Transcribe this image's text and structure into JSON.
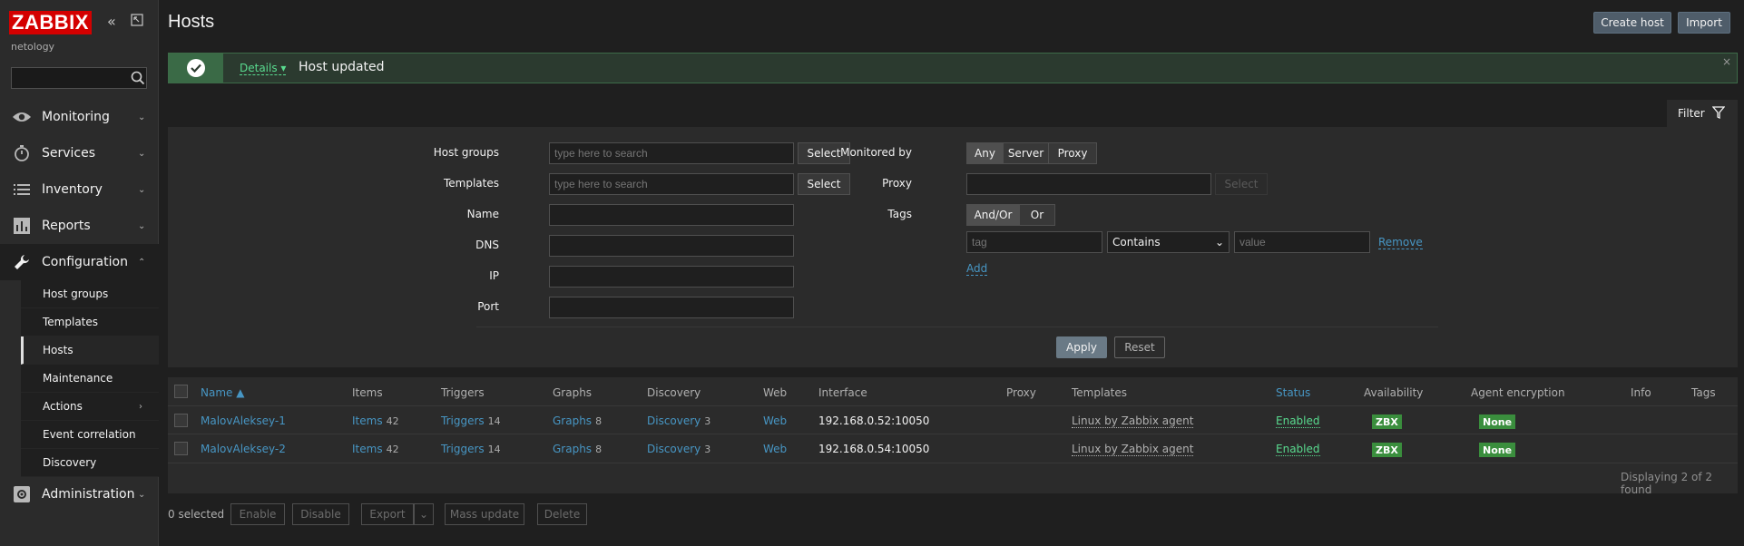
{
  "sidebar": {
    "logo": "ZABBIX",
    "collapse_icon": "double-chevron-left-icon",
    "kiosk_icon": "kiosk-icon",
    "server_name": "netology",
    "search_placeholder": "",
    "menu": [
      {
        "label": "Monitoring",
        "icon": "eye-icon"
      },
      {
        "label": "Services",
        "icon": "clock-icon"
      },
      {
        "label": "Inventory",
        "icon": "list-icon"
      },
      {
        "label": "Reports",
        "icon": "bar-chart-icon"
      },
      {
        "label": "Configuration",
        "icon": "wrench-icon"
      },
      {
        "label": "Administration",
        "icon": "gear-icon"
      }
    ],
    "config_items": [
      "Host groups",
      "Templates",
      "Hosts",
      "Maintenance",
      "Actions",
      "Event correlation",
      "Discovery"
    ]
  },
  "header": {
    "title": "Hosts",
    "create_host": "Create host",
    "import": "Import"
  },
  "message": {
    "details": "Details",
    "text": "Host updated",
    "close": "×"
  },
  "filter": {
    "tab_label": "Filter",
    "host_groups_label": "Host groups",
    "host_groups_placeholder": "type here to search",
    "templates_label": "Templates",
    "templates_placeholder": "type here to search",
    "select": "Select",
    "name_label": "Name",
    "dns_label": "DNS",
    "ip_label": "IP",
    "port_label": "Port",
    "monitored_by_label": "Monitored by",
    "monitored_by_options": [
      "Any",
      "Server",
      "Proxy"
    ],
    "proxy_label": "Proxy",
    "tags_label": "Tags",
    "tags_options": [
      "And/Or",
      "Or"
    ],
    "tag_placeholder": "tag",
    "operator": "Contains",
    "value_placeholder": "value",
    "remove": "Remove",
    "add": "Add",
    "apply": "Apply",
    "reset": "Reset"
  },
  "table": {
    "columns": [
      "Name ▲",
      "Items",
      "Triggers",
      "Graphs",
      "Discovery",
      "Web",
      "Interface",
      "Proxy",
      "Templates",
      "Status",
      "Availability",
      "Agent encryption",
      "Info",
      "Tags"
    ],
    "rows": [
      {
        "name": "MalovAleksey-1",
        "items": "Items",
        "items_count": "42",
        "triggers": "Triggers",
        "triggers_count": "14",
        "graphs": "Graphs",
        "graphs_count": "8",
        "discovery": "Discovery",
        "discovery_count": "3",
        "web": "Web",
        "interface": "192.168.0.52:10050",
        "template": "Linux by Zabbix agent",
        "status": "Enabled",
        "availability": "ZBX",
        "encryption": "None"
      },
      {
        "name": "MalovAleksey-2",
        "items": "Items",
        "items_count": "42",
        "triggers": "Triggers",
        "triggers_count": "14",
        "graphs": "Graphs",
        "graphs_count": "8",
        "discovery": "Discovery",
        "discovery_count": "3",
        "web": "Web",
        "interface": "192.168.0.54:10050",
        "template": "Linux by Zabbix agent",
        "status": "Enabled",
        "availability": "ZBX",
        "encryption": "None"
      }
    ],
    "footer": "Displaying 2 of 2 found"
  },
  "actions": {
    "selected": "0 selected",
    "enable": "Enable",
    "disable": "Disable",
    "export": "Export",
    "mass_update": "Mass update",
    "delete": "Delete"
  },
  "colors": {
    "accent_link": "#4796c4",
    "enabled_green": "#59db8f",
    "badge_green": "#3a8e3d",
    "logo_red": "#d40000"
  }
}
